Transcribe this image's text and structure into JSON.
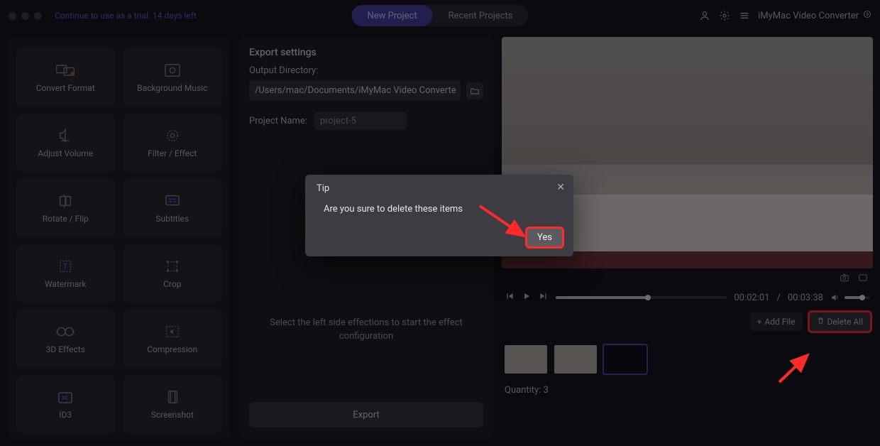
{
  "titlebar": {
    "trial_text": "Continue to use as a trial: 14 days left",
    "tab_new": "New Project",
    "tab_recent": "Recent Projects",
    "brand": "iMyMac Video Converter"
  },
  "sidebar": {
    "tiles": [
      {
        "label": "Convert Format",
        "icon": "convert-format-icon"
      },
      {
        "label": "Background Music",
        "icon": "background-music-icon"
      },
      {
        "label": "Adjust Volume",
        "icon": "adjust-volume-icon"
      },
      {
        "label": "Filter / Effect",
        "icon": "filter-effect-icon"
      },
      {
        "label": "Rotate / Flip",
        "icon": "rotate-flip-icon"
      },
      {
        "label": "Subtitles",
        "icon": "subtitles-icon"
      },
      {
        "label": "Watermark",
        "icon": "watermark-icon"
      },
      {
        "label": "Crop",
        "icon": "crop-icon"
      },
      {
        "label": "3D Effects",
        "icon": "3d-effects-icon"
      },
      {
        "label": "Compression",
        "icon": "compression-icon"
      },
      {
        "label": "ID3",
        "icon": "id3-icon"
      },
      {
        "label": "Screenshot",
        "icon": "screenshot-icon"
      }
    ]
  },
  "center": {
    "heading": "Export settings",
    "output_label": "Output Directory:",
    "output_path": "/Users/mac/Documents/iMyMac Video Converte",
    "project_label": "Project Name:",
    "project_value": "project-5",
    "message": "Select the left side effections to start the effect configuration",
    "export_label": "Export"
  },
  "player": {
    "current_time": "00:02:01",
    "total_time": "00:03:38"
  },
  "actions": {
    "add_file": "Add File",
    "delete_all": "Delete All"
  },
  "quantity_label": "Quantity: 3",
  "modal": {
    "title": "Tip",
    "text": "Are you sure to delete these items",
    "yes": "Yes"
  }
}
